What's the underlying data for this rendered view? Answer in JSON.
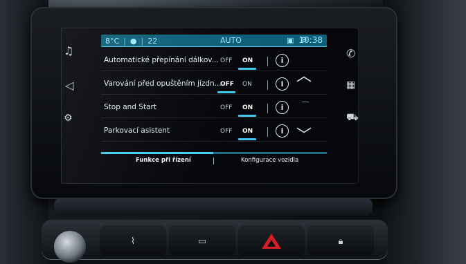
{
  "status_bar": {
    "temp_left": "8°C",
    "fan_sep": "|",
    "temp_right": "22",
    "mode": "AUTO",
    "clock": "10:38"
  },
  "settings": [
    {
      "label": "Automatické přepínání dálkov...",
      "off": "OFF",
      "on": "ON",
      "state": "on"
    },
    {
      "label": "Varování před opuštěním jízdn...",
      "off": "OFF",
      "on": "ON",
      "state": "off"
    },
    {
      "label": "Stop and Start",
      "off": "OFF",
      "on": "ON",
      "state": "on"
    },
    {
      "label": "Parkovací asistent",
      "off": "OFF",
      "on": "ON",
      "state": "on"
    }
  ],
  "info_symbol": "i",
  "tabs": [
    {
      "label": "Funkce při řízení",
      "active": true
    },
    {
      "label": "Konfigurace vozidla",
      "active": false
    }
  ],
  "icons": {
    "left": [
      "music-note-icon",
      "navigation-icon",
      "car-settings-icon"
    ],
    "right": [
      "phone-icon",
      "apps-grid-icon",
      "car-icon"
    ],
    "scroll": [
      "chevron-up-icon",
      "chevron-down-icon"
    ],
    "console": [
      "front-defrost-icon",
      "rear-defrost-icon",
      "hazard-icon",
      "lock-icon"
    ]
  },
  "colors": {
    "accent": "#44c7ef",
    "statusbar_bg": "#0e5f79",
    "hazard": "#d31e26"
  }
}
